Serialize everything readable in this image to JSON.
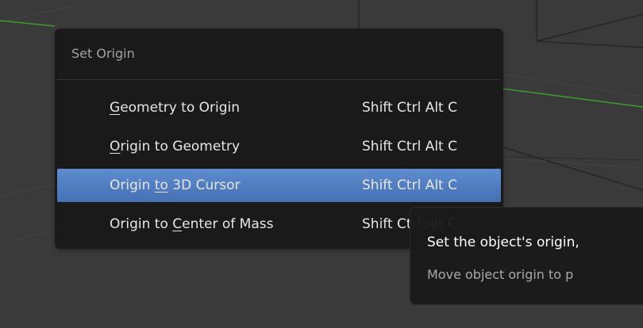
{
  "menu": {
    "title": "Set Origin",
    "items": [
      {
        "pre": "",
        "mnemonic": "G",
        "post": "eometry to Origin",
        "shortcut": "Shift Ctrl Alt C",
        "highlighted": false
      },
      {
        "pre": "",
        "mnemonic": "O",
        "post": "rigin to Geometry",
        "shortcut": "Shift Ctrl Alt C",
        "highlighted": false
      },
      {
        "pre": "Origin ",
        "mnemonic": "to",
        "post": " 3D Cursor",
        "shortcut": "Shift Ctrl Alt C",
        "highlighted": true
      },
      {
        "pre": "Origin to ",
        "mnemonic": "C",
        "post": "enter of Mass",
        "shortcut": "Shift Ctrl Alt C",
        "highlighted": false
      }
    ]
  },
  "tooltip": {
    "title": "Set the object's origin,",
    "description": "Move object origin to p"
  },
  "colors": {
    "viewport_bg": "#3a3a3a",
    "menu_bg": "#181818",
    "highlight": "#5680c2",
    "axis_line": "#3e9a2e"
  }
}
